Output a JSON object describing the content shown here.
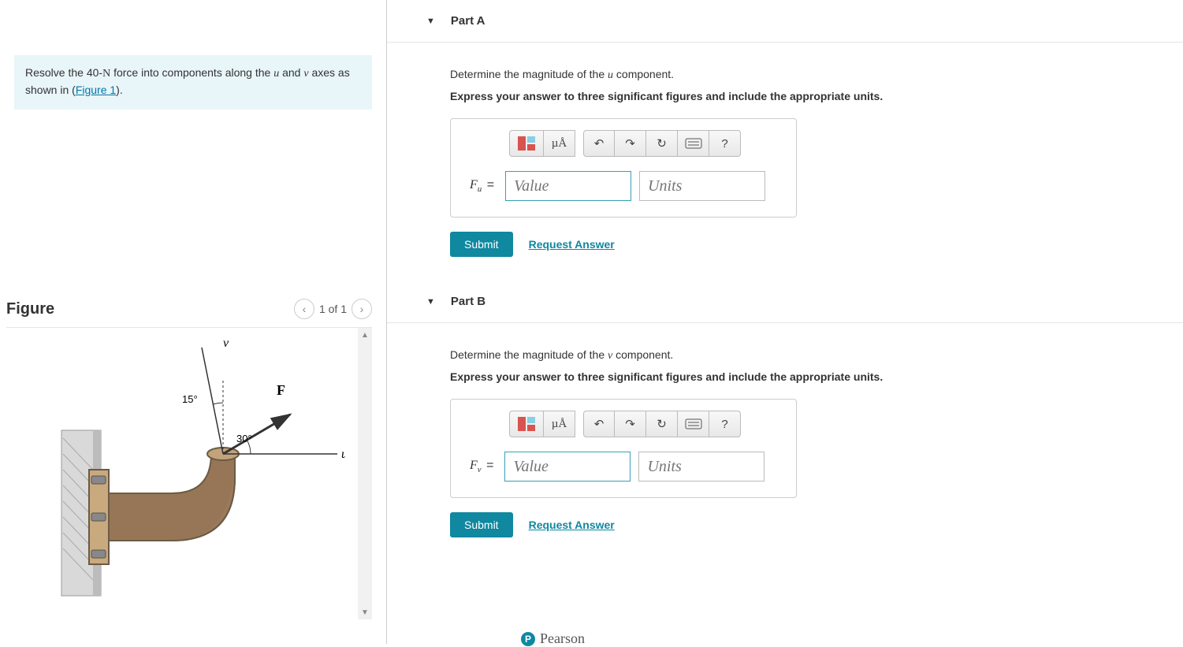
{
  "problem": {
    "text_prefix": "Resolve the 40-",
    "force_symbol": "N",
    "text_mid": " force into components along the ",
    "var_u": "u",
    "text_and": " and ",
    "var_v": "v",
    "text_suffix": " axes as shown in (",
    "link_text": "Figure 1",
    "text_end": ")."
  },
  "figure": {
    "title": "Figure",
    "pager": "1 of 1",
    "labels": {
      "v": "v",
      "u": "u",
      "F": "F",
      "angle_top": "15°",
      "angle_bottom": "30°"
    }
  },
  "parts": {
    "a": {
      "title": "Part A",
      "instruction_prefix": "Determine the magnitude of the ",
      "var": "u",
      "instruction_suffix": " component.",
      "bold": "Express your answer to three significant figures and include the appropriate units.",
      "var_label": "F",
      "var_sub": "u",
      "value_placeholder": "Value",
      "units_placeholder": "Units",
      "submit": "Submit",
      "request": "Request Answer"
    },
    "b": {
      "title": "Part B",
      "instruction_prefix": "Determine the magnitude of the ",
      "var": "v",
      "instruction_suffix": " component.",
      "bold": "Express your answer to three significant figures and include the appropriate units.",
      "var_label": "F",
      "var_sub": "v",
      "value_placeholder": "Value",
      "units_placeholder": "Units",
      "submit": "Submit",
      "request": "Request Answer"
    }
  },
  "toolbar": {
    "units_btn": "µÅ",
    "help": "?"
  },
  "brand": "Pearson"
}
